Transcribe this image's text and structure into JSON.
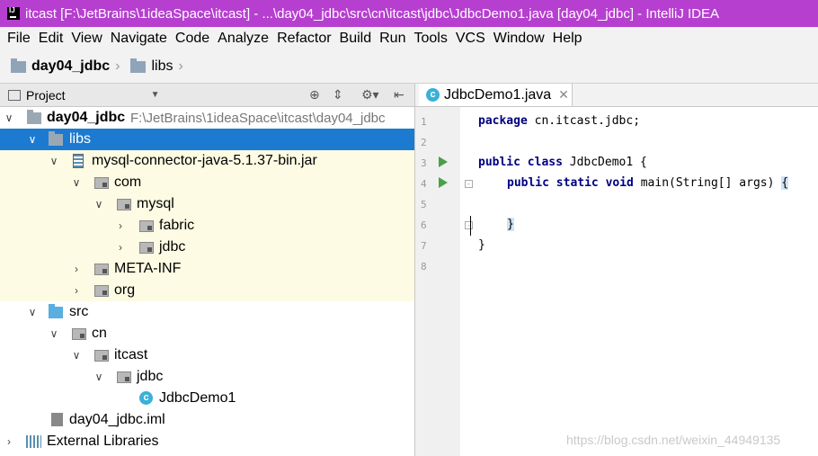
{
  "window": {
    "title": "itcast [F:\\JetBrains\\1ideaSpace\\itcast] - ...\\day04_jdbc\\src\\cn\\itcast\\jdbc\\JdbcDemo1.java [day04_jdbc] - IntelliJ IDEA"
  },
  "menu": [
    "File",
    "Edit",
    "View",
    "Navigate",
    "Code",
    "Analyze",
    "Refactor",
    "Build",
    "Run",
    "Tools",
    "VCS",
    "Window",
    "Help"
  ],
  "breadcrumb": {
    "item1": "day04_jdbc",
    "item2": "libs"
  },
  "project_panel": {
    "title": "Project"
  },
  "tree": {
    "root": {
      "label": "day04_jdbc",
      "path": "F:\\JetBrains\\1ideaSpace\\itcast\\day04_jdbc"
    },
    "libs": "libs",
    "jar": "mysql-connector-java-5.1.37-bin.jar",
    "com": "com",
    "mysql": "mysql",
    "fabric": "fabric",
    "jdbc_pkg": "jdbc",
    "metainf": "META-INF",
    "org": "org",
    "src": "src",
    "cn": "cn",
    "itcast": "itcast",
    "jdbc": "jdbc",
    "class": "JdbcDemo1",
    "iml": "day04_jdbc.iml",
    "external": "External Libraries"
  },
  "editor": {
    "tab": "JdbcDemo1.java",
    "line_numbers": [
      "1",
      "2",
      "3",
      "4",
      "5",
      "6",
      "7",
      "8"
    ],
    "lines": {
      "l1_kw": "package",
      "l1_rest": " cn.itcast.jdbc;",
      "l3_kw": "public class",
      "l3_rest": " JdbcDemo1 {",
      "l4_kw": "public static void",
      "l4_rest": " main(String[] args) ",
      "l4_brace": "{",
      "l6_brace": "}",
      "l7": "}"
    }
  },
  "watermark": "https://blog.csdn.net/weixin_44949135"
}
